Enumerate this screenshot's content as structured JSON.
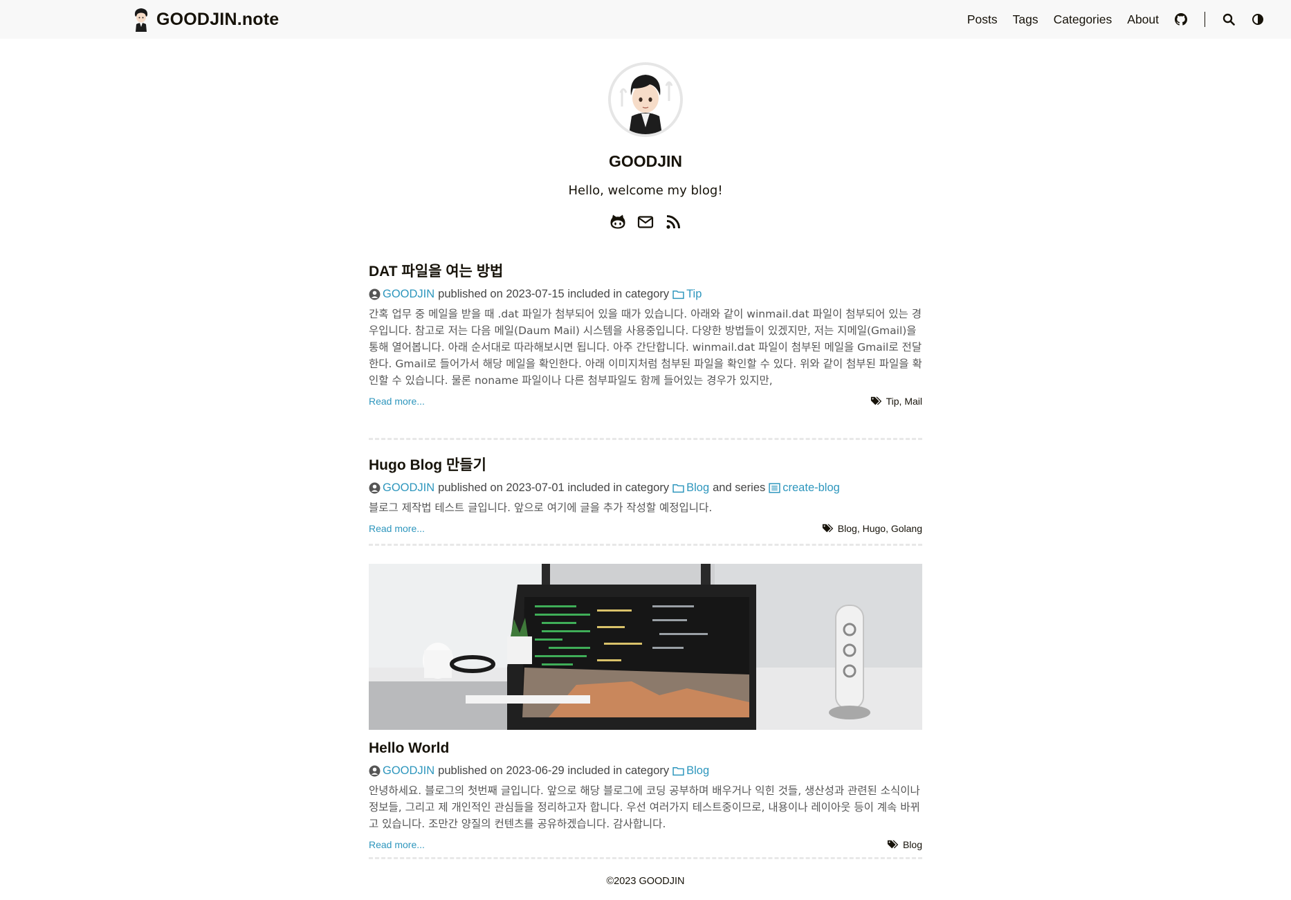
{
  "header": {
    "brand": "GOODJIN.note",
    "menu": [
      {
        "label": "Posts"
      },
      {
        "label": "Tags"
      },
      {
        "label": "Categories"
      },
      {
        "label": "About"
      }
    ],
    "icons": [
      "github-icon",
      "search-icon",
      "theme-toggle-icon"
    ]
  },
  "profile": {
    "name": "GOODJIN",
    "subtitle": "Hello, welcome my blog!",
    "social": [
      "github-icon",
      "mail-icon",
      "rss-icon"
    ]
  },
  "posts": [
    {
      "title": "DAT 파일을 여는 방법",
      "author": "GOODJIN",
      "published_text": "published on 2023-07-15 included in category",
      "category": "Tip",
      "summary": "간혹 업무 중 메일을 받을 때 .dat 파일가 첨부되어 있을 때가 있습니다. 아래와 같이 winmail.dat 파일이 첨부되어 있는 경우입니다. 참고로 저는 다음 메일(Daum Mail) 시스템을 사용중입니다. 다양한 방법들이 있겠지만, 저는 지메일(Gmail)을 통해 열어봅니다. 아래 순서대로 따라해보시면 됩니다. 아주 간단합니다. winmail.dat 파일이 첨부된 메일을 Gmail로 전달한다. Gmail로 들어가서 해당 메일을 확인한다. 아래 이미지처럼 첨부된 파일을 확인할 수 있다. 위와 같이 첨부된 파일을 확인할 수 있습니다. 물론 noname 파일이나 다른 첨부파일도 함께 들어있는 경우가 있지만,",
      "read_more": "Read more...",
      "tags": "Tip, Mail"
    },
    {
      "title": "Hugo Blog 만들기",
      "author": "GOODJIN",
      "published_text": "published on 2023-07-01 included in category",
      "category": "Blog",
      "series_text": "and series",
      "series": "create-blog",
      "summary": "블로그 제작법 테스트 글입니다. 앞으로 여기에 글을 추가 작성할 예정입니다.",
      "read_more": "Read more...",
      "tags": "Blog, Hugo, Golang"
    },
    {
      "title": "Hello World",
      "author": "GOODJIN",
      "published_text": "published on 2023-06-29 included in category",
      "category": "Blog",
      "summary": "안녕하세요. 블로그의 첫번째 글입니다. 앞으로 해당 블로그에 코딩 공부하며 배우거나 익힌 것들, 생산성과 관련된 소식이나 정보들, 그리고 제 개인적인 관심들을 정리하고자 합니다. 우선 여러가지 테스트중이므로, 내용이나 레이아웃 등이 계속 바뀌고 있습니다. 조만간 양질의 컨텐츠를 공유하겠습니다. 감사합니다.",
      "read_more": "Read more...",
      "tags": "Blog",
      "has_cover_image": true
    }
  ],
  "footer": {
    "text": "©2023 GOODJIN"
  },
  "colors": {
    "link": "#2d96bd",
    "header_bg": "#f8f8f8",
    "text": "#161209",
    "divider": "#e8e8e8"
  }
}
